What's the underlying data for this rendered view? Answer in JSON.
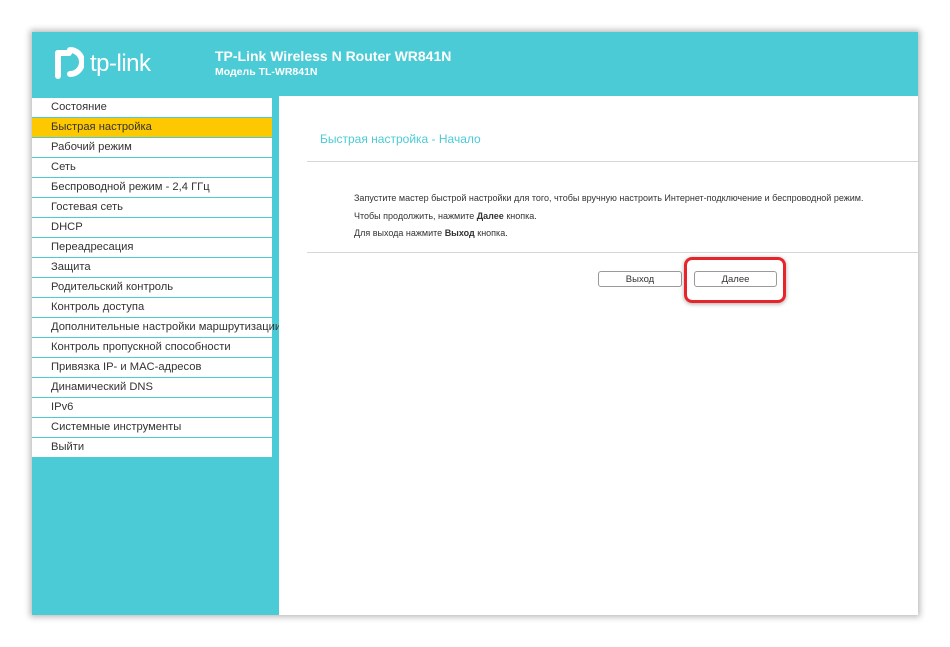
{
  "header": {
    "logo_text": "tp-link",
    "product_title": "TP-Link Wireless N Router WR841N",
    "model_label": "Модель",
    "model_value": "TL-WR841N"
  },
  "sidebar": {
    "items": [
      {
        "label": "Состояние"
      },
      {
        "label": "Быстрая настройка",
        "active": true
      },
      {
        "label": "Рабочий режим"
      },
      {
        "label": "Сеть"
      },
      {
        "label": "Беспроводной режим - 2,4 ГГц"
      },
      {
        "label": "Гостевая сеть"
      },
      {
        "label": "DHCP"
      },
      {
        "label": "Переадресация"
      },
      {
        "label": "Защита"
      },
      {
        "label": "Родительский контроль"
      },
      {
        "label": "Контроль доступа"
      },
      {
        "label": "Дополнительные настройки маршрутизации"
      },
      {
        "label": "Контроль пропускной способности"
      },
      {
        "label": "Привязка IP- и MAC-адресов"
      },
      {
        "label": "Динамический DNS"
      },
      {
        "label": "IPv6"
      },
      {
        "label": "Системные инструменты"
      },
      {
        "label": "Выйти"
      }
    ]
  },
  "main": {
    "heading": "Быстрая настройка - Начало",
    "line1": "Запустите мастер быстрой настройки для того, чтобы вручную настроить Интернет-подключение и беспроводной режим.",
    "line2_pre": "Чтобы продолжить, нажмите",
    "line2_bold": "Далее",
    "line2_post": "кнопка.",
    "line3_pre": "Для выхода нажмите",
    "line3_bold": "Выход",
    "line3_post": "кнопка.",
    "exit_button": "Выход",
    "next_button": "Далее"
  },
  "colors": {
    "brand": "#4acbd6",
    "active_menu": "#fdc800",
    "highlight": "#e8242b"
  }
}
